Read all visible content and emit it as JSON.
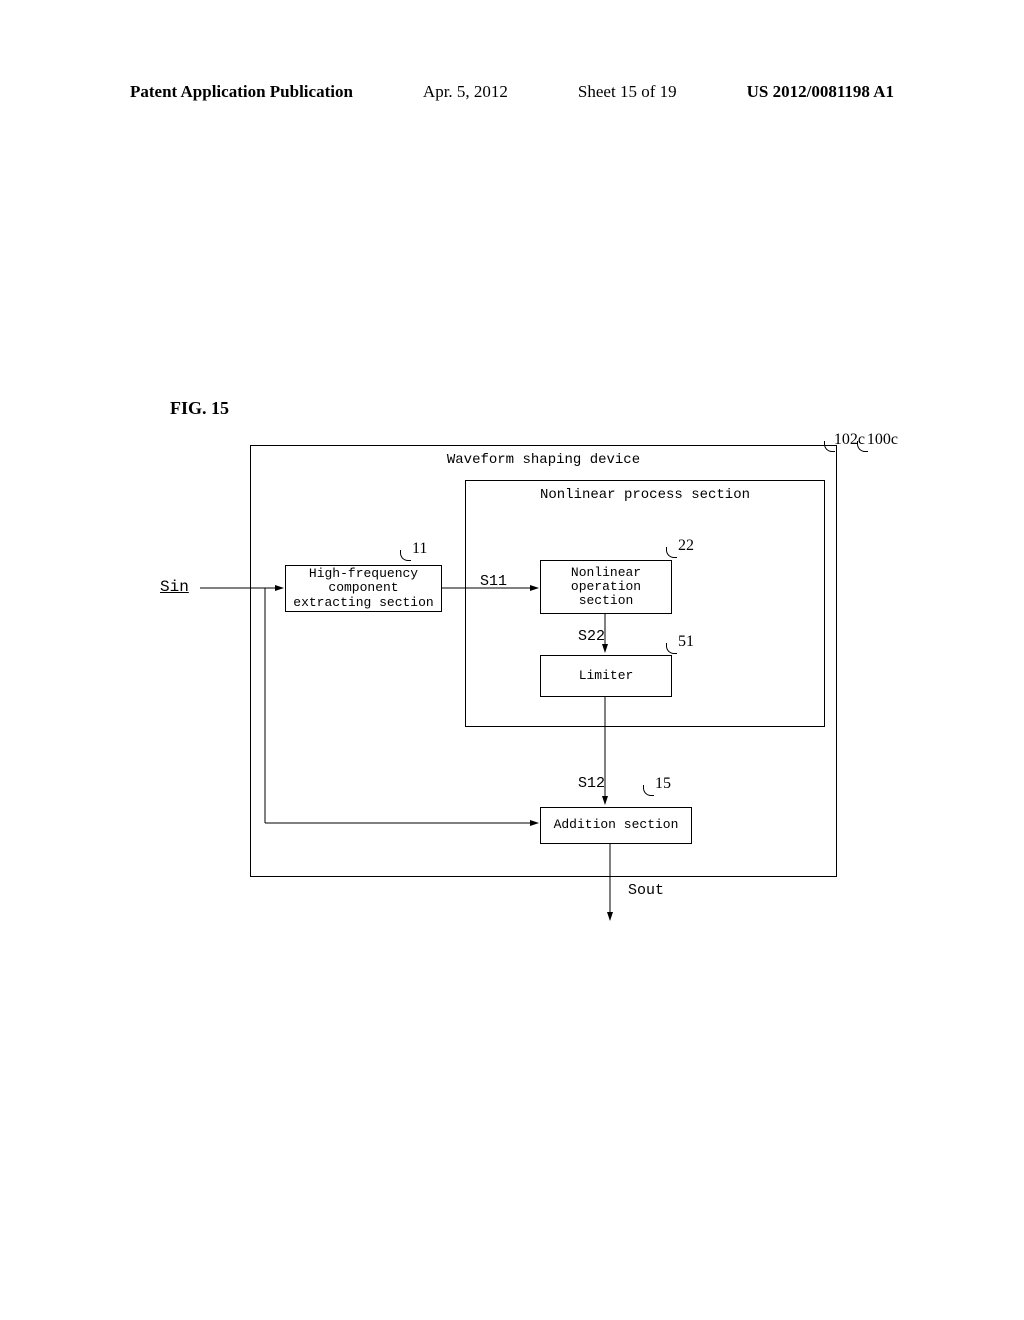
{
  "header": {
    "pub_label": "Patent Application Publication",
    "date": "Apr. 5, 2012",
    "sheet": "Sheet 15 of 19",
    "pub_number": "US 2012/0081198 A1"
  },
  "figure": {
    "label": "FIG. 15",
    "signal_in": "Sin",
    "signal_out": "Sout",
    "outer": {
      "title": "Waveform shaping device",
      "ref": "100c"
    },
    "inner": {
      "title": "Nonlinear process section",
      "ref": "102c"
    },
    "blocks": {
      "hf": {
        "label": "High-frequency\ncomponent\nextracting section",
        "ref": "11"
      },
      "nonlinear": {
        "label": "Nonlinear\noperation\nsection",
        "ref": "22"
      },
      "limiter": {
        "label": "Limiter",
        "ref": "51"
      },
      "addition": {
        "label": "Addition section",
        "ref": "15"
      }
    },
    "signals": {
      "s11": "S11",
      "s22": "S22",
      "s12": "S12"
    }
  }
}
